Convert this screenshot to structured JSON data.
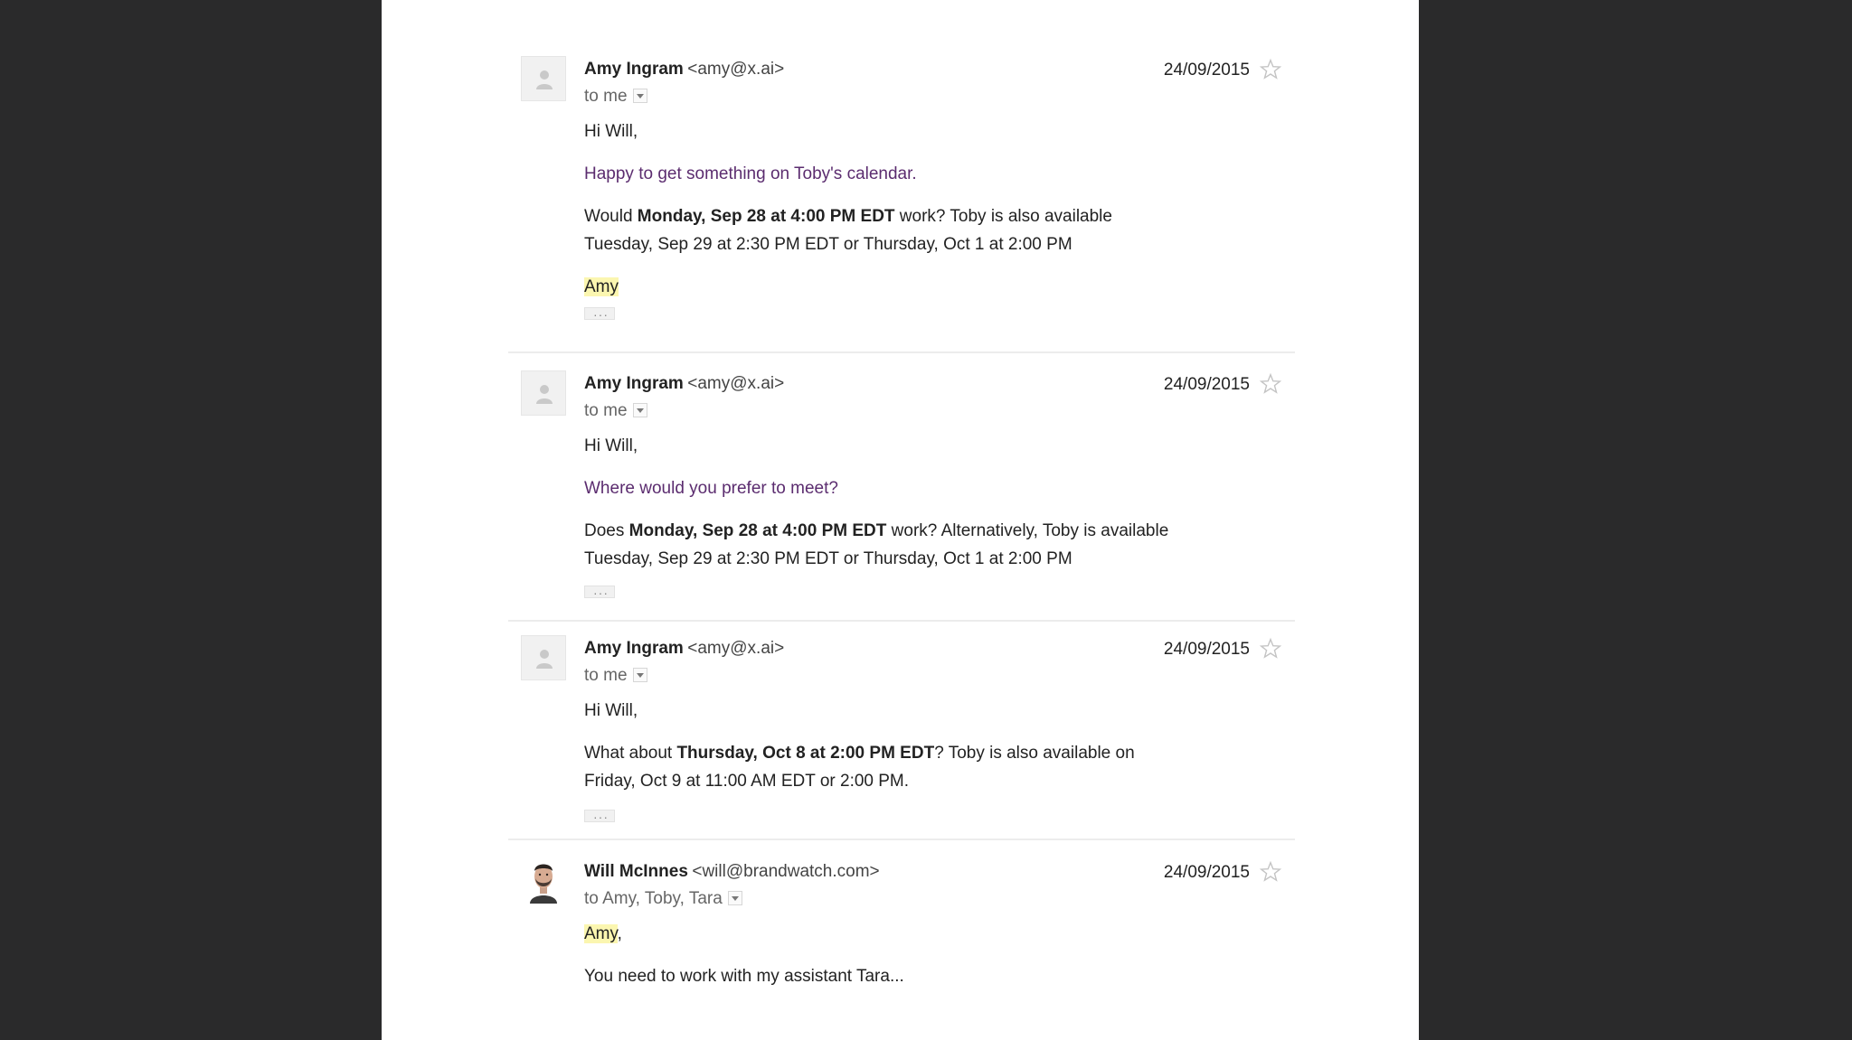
{
  "messages": [
    {
      "sender_name": "Amy Ingram",
      "sender_email": "<amy@x.ai>",
      "date": "24/09/2015",
      "recipients": "to me",
      "greeting": "Hi Will,",
      "intro": "Happy to get something on Toby's calendar.",
      "p1_pre": "Would ",
      "p1_bold": "Monday, Sep 28 at 4:00 PM EDT",
      "p1_post": " work? Toby is also available",
      "p1_line2": "Tuesday, Sep 29 at 2:30 PM EDT or Thursday, Oct 1 at 2:00 PM",
      "signature": "Amy"
    },
    {
      "sender_name": "Amy Ingram",
      "sender_email": "<amy@x.ai>",
      "date": "24/09/2015",
      "recipients": "to me",
      "greeting": "Hi Will,",
      "intro": "Where would you prefer to meet?",
      "p1_pre": "Does ",
      "p1_bold": "Monday, Sep 28 at 4:00 PM EDT",
      "p1_post": " work? Alternatively, Toby is available",
      "p1_line2": "Tuesday, Sep 29 at 2:30 PM EDT or Thursday, Oct 1 at 2:00 PM"
    },
    {
      "sender_name": "Amy Ingram",
      "sender_email": "<amy@x.ai>",
      "date": "24/09/2015",
      "recipients": "to me",
      "greeting": "Hi Will,",
      "p1_pre": "What about ",
      "p1_bold": "Thursday, Oct 8 at 2:00 PM EDT",
      "p1_post": "? Toby is also available on",
      "p1_line2": "Friday, Oct 9 at 11:00 AM EDT or 2:00 PM."
    },
    {
      "sender_name": "Will McInnes",
      "sender_email": "<will@brandwatch.com>",
      "date": "24/09/2015",
      "recipients": "to Amy, Toby, Tara",
      "greeting_name": "Amy",
      "greeting_punct": ",",
      "body": "You need to work with my assistant Tara..."
    }
  ],
  "icons": {
    "star": "star-outline-icon",
    "avatar_placeholder": "person-icon",
    "dropdown": "chevron-down-icon",
    "trimmed": "ellipsis-icon"
  },
  "colors": {
    "background": "#2a2a2b",
    "page": "#ffffff",
    "intro_text": "#5b2c6f",
    "highlight": "#fbf6b0"
  }
}
